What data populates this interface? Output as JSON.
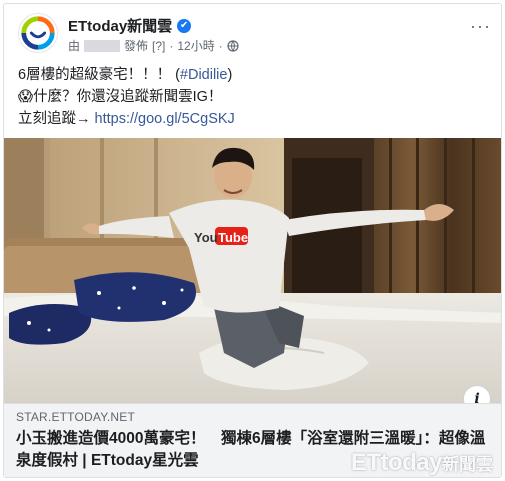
{
  "post": {
    "page_name": "ETtoday新聞雲",
    "meta_prefix": "由",
    "meta_suffix": "發佈",
    "meta_help": "[?]",
    "time": "12小時",
    "menu_label": "···",
    "text_line1_prefix": "6層樓的超級豪宅！！！ (",
    "text_line1_hashtag": "#Didilie",
    "text_line1_suffix": ")",
    "text_line2": "😱什麼？你還沒追蹤新聞雲IG！",
    "text_line3_prefix": "立刻追蹤→ ",
    "text_line3_link": "https://goo.gl/5CgSKJ"
  },
  "photo": {
    "shirt_logo_you": "You",
    "shirt_logo_tube": "Tube"
  },
  "link_preview": {
    "domain": "STAR.ETTODAY.NET",
    "headline": "小玉搬進造價4000萬豪宅！　獨棟6層樓「浴室還附三溫暖」：超像溫泉度假村 | ETtoday星光雲",
    "info_label": "i"
  },
  "watermark": {
    "brand": "ETtoday",
    "suffix": "新聞雲"
  },
  "colors": {
    "link": "#385898",
    "verified": "#1877f2",
    "preview_bg": "#f2f3f5"
  }
}
